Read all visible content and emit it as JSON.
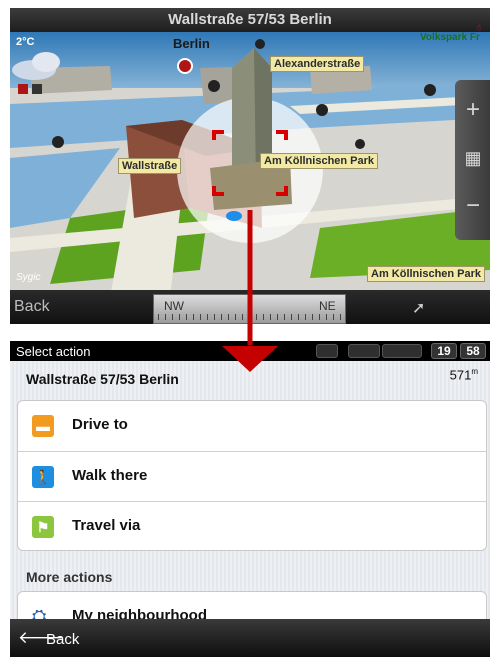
{
  "map": {
    "title": "Wallstraße 57/53  Berlin",
    "temperature": "2°C",
    "city_label": "Berlin",
    "park_label": "Volkspark Fr",
    "street_labels": [
      "Alexanderstraße",
      "Wallstraße",
      "Am Köllnischen Park",
      "Am Köllnischen Park"
    ],
    "branding": "Sygic",
    "back_label": "Back",
    "compass": {
      "left": "NW",
      "right": "NE"
    },
    "zoom_in": "+",
    "zoom_out": "−",
    "grid_icon": "grid-icon",
    "turn_icon": "turn-arrow-icon"
  },
  "menu": {
    "status": {
      "title": "Select action",
      "hour": "19",
      "minute": "58"
    },
    "address": "Wallstraße 57/53  Berlin",
    "distance": "571",
    "distance_unit": "m",
    "actions": [
      {
        "label": "Drive to",
        "icon": "car-icon",
        "color": "#f39a21"
      },
      {
        "label": "Walk there",
        "icon": "pedestrian-icon",
        "color": "#1e8fe0"
      },
      {
        "label": "Travel via",
        "icon": "flag-icon",
        "color": "#8cc63f"
      }
    ],
    "more_actions_title": "More actions",
    "more_actions": [
      {
        "label": "My neighbourhood",
        "icon": "neighbourhood-icon"
      }
    ],
    "back_label": "Back"
  }
}
